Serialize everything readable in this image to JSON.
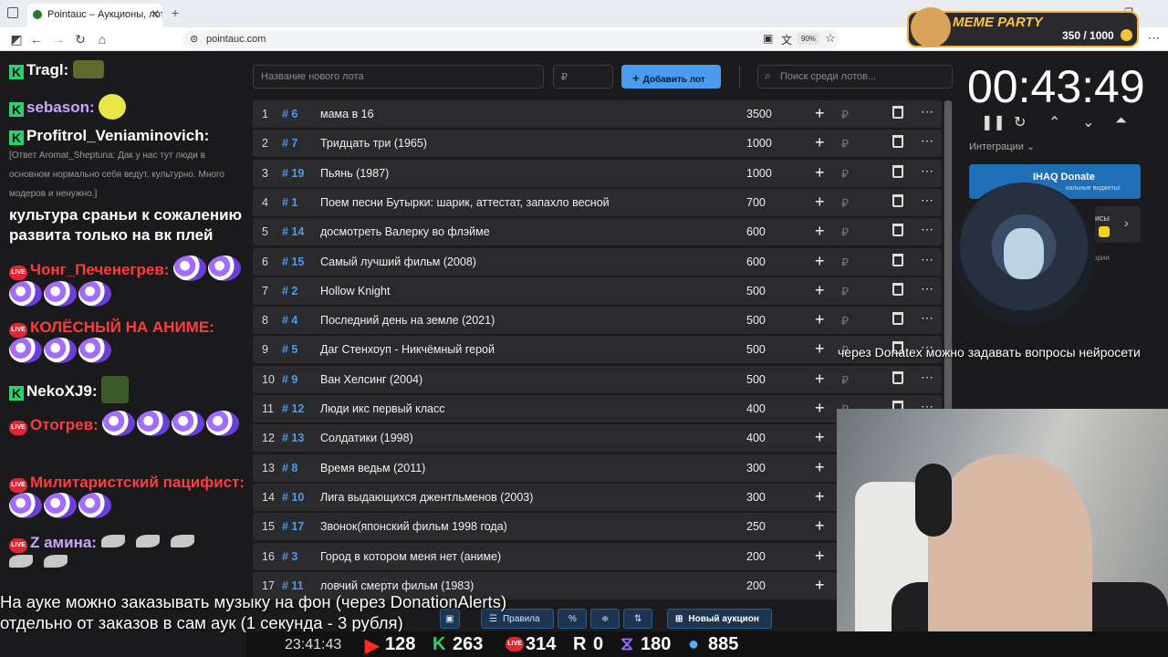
{
  "browser": {
    "tab_title": "Pointauc – Аукционы, лотереи",
    "url": "pointauc.com",
    "zoom": "90%"
  },
  "meme_party": {
    "title": "MEME PARTY",
    "count": "350 / 1000"
  },
  "chat": [
    {
      "badge": "k",
      "name": "Tragl:",
      "name_color": "white"
    },
    {
      "badge": "k",
      "name": "sebason:",
      "name_color": "purple"
    },
    {
      "badge": "k",
      "name": "Profitrol_Veniaminovich:",
      "name_color": "white"
    },
    {
      "reply": "[Ответ Aromat_Sheptuna: Дак у нас тут люди в основном нормально себя ведут, культурно. Много модеров и ненужно.]"
    },
    {
      "text": "культура сраньи к сожалению развита только на вк плей"
    },
    {
      "badge": "live",
      "name": "Чонг_Печенегрев:"
    },
    {
      "badge": "live",
      "name": "КОЛЁСНЫЙ НА АНИМЕ:"
    },
    {
      "badge": "k",
      "name": "NekoXJ9:"
    },
    {
      "badge": "live",
      "name": "Отогрев:"
    },
    {
      "badge": "live",
      "name": "Милитаристский пацифист:"
    },
    {
      "badge": "live",
      "name": "Z амина:"
    }
  ],
  "controls": {
    "lot_placeholder": "Название нового лота",
    "amount_placeholder": "₽",
    "add_button": "Добавить лот",
    "search_placeholder": "Поиск среди лотов..."
  },
  "lots": [
    {
      "n": "1",
      "id": "# 6",
      "name": "мама в 16",
      "amount": "3500"
    },
    {
      "n": "2",
      "id": "# 7",
      "name": "Тридцать три (1965)",
      "amount": "1000"
    },
    {
      "n": "3",
      "id": "# 19",
      "name": "Пьянь (1987)",
      "amount": "1000"
    },
    {
      "n": "4",
      "id": "# 1",
      "name": "Поем песни Бутырки: шарик, аттестат, запахло весной",
      "amount": "700"
    },
    {
      "n": "5",
      "id": "# 14",
      "name": "досмотреть Валерку во флэйме",
      "amount": "600"
    },
    {
      "n": "6",
      "id": "# 15",
      "name": "Самый лучший фильм (2008)",
      "amount": "600"
    },
    {
      "n": "7",
      "id": "# 2",
      "name": "Hollow Knight",
      "amount": "500"
    },
    {
      "n": "8",
      "id": "# 4",
      "name": "Последний день на земле (2021)",
      "amount": "500"
    },
    {
      "n": "9",
      "id": "# 5",
      "name": "Даг Стенхоуп - Никчёмный герой",
      "amount": "500"
    },
    {
      "n": "10",
      "id": "# 9",
      "name": "Ван Хелсинг (2004)",
      "amount": "500"
    },
    {
      "n": "11",
      "id": "# 12",
      "name": "Люди икс первый класс",
      "amount": "400"
    },
    {
      "n": "12",
      "id": "# 13",
      "name": "Солдатики (1998)",
      "amount": "400"
    },
    {
      "n": "13",
      "id": "# 8",
      "name": "Время ведьм (2011)",
      "amount": "300"
    },
    {
      "n": "14",
      "id": "# 10",
      "name": "Лига выдающихся джентльменов (2003)",
      "amount": "300"
    },
    {
      "n": "15",
      "id": "# 17",
      "name": "Звонок(японский фильм 1998 года)",
      "amount": "250"
    },
    {
      "n": "16",
      "id": "# 3",
      "name": "Город в котором меня нет (аниме)",
      "amount": "200"
    },
    {
      "n": "17",
      "id": "# 11",
      "name": "ловчий смерти фильм (1983)",
      "amount": "200"
    }
  ],
  "timer": {
    "value": "00:43:49"
  },
  "right": {
    "integrations": "Интеграции",
    "ihaq_title": "IHAQ Donate",
    "ihaq_sub": "кальные виджеты!",
    "panel_text": "исы",
    "panel_sub": "ории"
  },
  "overlay": {
    "donatex": "через Donatex можно задавать вопросы нейросети",
    "subtitle_1": "На ауке можно заказывать музыку на фон (через DonationAlerts)",
    "subtitle_2": "отдельно от заказов в сам аук (1 секунда - 3 рубля)"
  },
  "toolbar": {
    "rules": "Правила",
    "percent": "%",
    "new_auction": "Новый аукцион"
  },
  "stats": {
    "time": "23:41:43",
    "youtube": "128",
    "kick": "263",
    "vkplay": "314",
    "rumble": "0",
    "twitch": "180",
    "viewers": "885"
  }
}
